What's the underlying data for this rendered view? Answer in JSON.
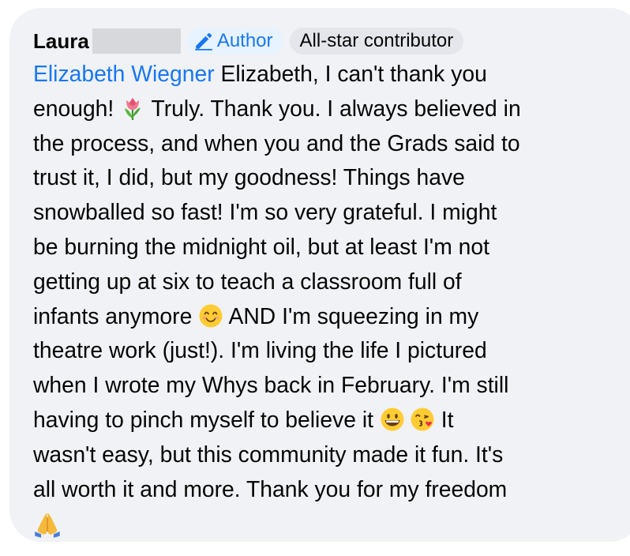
{
  "comment": {
    "author_name": "Laura",
    "badges": {
      "author_label": "Author",
      "allstar_label": "All-star contributor"
    },
    "mention": "Elizabeth Wiegner",
    "lines": {
      "l1": " Elizabeth, I can't thank you",
      "l2a": "enough! ",
      "l2b": " Truly. Thank you. I always believed in",
      "l3": "the process, and when you and the Grads said to",
      "l4": "trust it, I did, but my goodness! Things have",
      "l5": "snowballed so fast! I'm so very grateful. I might",
      "l6": "be burning the midnight oil, but at least I'm not",
      "l7": "getting up at six to teach a classroom full of",
      "l8a": "infants anymore ",
      "l8b": " AND I'm squeezing in my",
      "l9": "theatre work (just!). I'm living the life I pictured",
      "l10": "when I wrote my Whys back in February. I'm still",
      "l11a": "having to pinch myself to believe it ",
      "l11b": " It",
      "l12": "wasn't easy, but this community made it fun. It's",
      "l13": "all worth it and more. Thank you for my freedom"
    },
    "emojis": [
      "tulip",
      "smiling-face",
      "grinning-face",
      "kissing-face-heart",
      "folded-hands"
    ]
  },
  "colors": {
    "bubble_bg": "#f0f2f5",
    "mention_blue": "#1877f2",
    "text": "#050505"
  }
}
